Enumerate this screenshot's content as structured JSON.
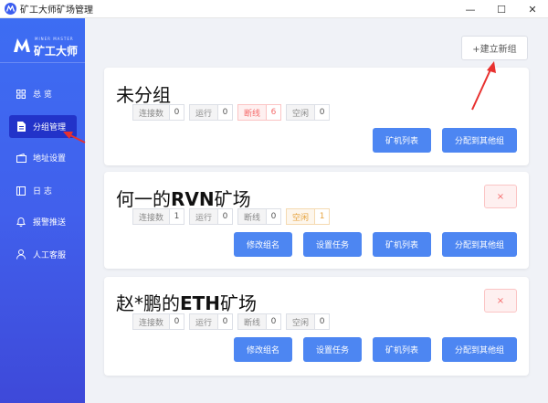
{
  "window": {
    "title": "矿工大师矿场管理",
    "minimize": "—",
    "maximize": "☐",
    "close": "✕"
  },
  "brand": {
    "subtitle": "MINER MASTER",
    "name": "矿工大师"
  },
  "sidebar": {
    "items": [
      {
        "label": "总 览",
        "icon": "grid-icon"
      },
      {
        "label": "分组管理",
        "icon": "document-icon"
      },
      {
        "label": "地址设置",
        "icon": "wallet-icon"
      },
      {
        "label": "日 志",
        "icon": "log-icon"
      },
      {
        "label": "报警推送",
        "icon": "bell-icon"
      },
      {
        "label": "人工客服",
        "icon": "user-icon"
      }
    ],
    "active_index": 1
  },
  "toolbar": {
    "new_group_label": "+建立新组"
  },
  "stat_labels": {
    "connections": "连接数",
    "running": "运行",
    "offline": "断线",
    "idle": "空闲"
  },
  "groups": [
    {
      "title_prefix": "未分组",
      "title_code": "",
      "title_suffix": "",
      "stats": {
        "connections": "0",
        "running": "0",
        "offline": "6",
        "idle": "0"
      },
      "buttons": {
        "miner_list": "矿机列表",
        "assign": "分配到其他组"
      }
    },
    {
      "title_prefix": "何一的",
      "title_code": "RVN",
      "title_suffix": "矿场",
      "stats": {
        "connections": "1",
        "running": "0",
        "offline": "0",
        "idle": "1"
      },
      "buttons": {
        "rename": "修改组名",
        "set_task": "设置任务",
        "miner_list": "矿机列表",
        "assign": "分配到其他组"
      },
      "delete_label": "×"
    },
    {
      "title_prefix": "赵*鹏的",
      "title_code": "ETH",
      "title_suffix": "矿场",
      "stats": {
        "connections": "0",
        "running": "0",
        "offline": "0",
        "idle": "0"
      },
      "buttons": {
        "rename": "修改组名",
        "set_task": "设置任务",
        "miner_list": "矿机列表",
        "assign": "分配到其他组"
      },
      "delete_label": "×"
    }
  ],
  "colors": {
    "accent": "#4d86f2",
    "sidebar": "#3f5ef0",
    "danger": "#f56c6c",
    "warning": "#e6a23c",
    "annotation": "#e8312f"
  }
}
